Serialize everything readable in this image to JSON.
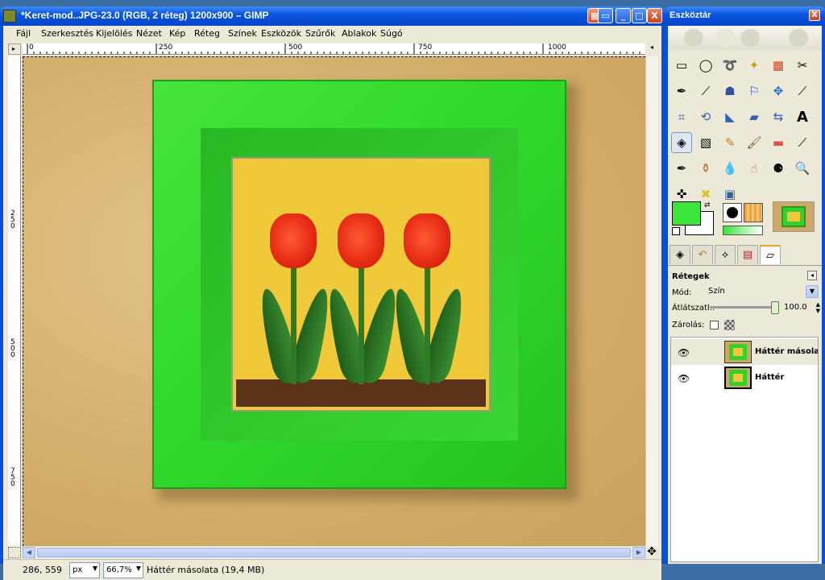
{
  "main_window": {
    "title": "*Keret-mod..JPG-23.0 (RGB, 2 réteg) 1200x900 – GIMP",
    "buttons": {
      "dock": "▦",
      "minimize": "_",
      "maximize": "□",
      "close": "X"
    }
  },
  "menu": [
    {
      "label": "Fájl"
    },
    {
      "label": "Szerkesztés"
    },
    {
      "label": "Kijelölés"
    },
    {
      "label": "Nézet"
    },
    {
      "label": "Kép"
    },
    {
      "label": "Réteg"
    },
    {
      "label": "Színek"
    },
    {
      "label": "Eszközök"
    },
    {
      "label": "Szűrők"
    },
    {
      "label": "Ablakok"
    },
    {
      "label": "Súgó"
    }
  ],
  "ruler_h": {
    "labels": [
      "0",
      "250",
      "500",
      "750",
      "1000"
    ]
  },
  "ruler_v": {
    "labels": [
      "250",
      "500",
      "750"
    ]
  },
  "status": {
    "coords": "286, 559",
    "unit": "px",
    "zoom": "66,7%",
    "info": "Háttér másolata (19,4 MB)"
  },
  "toolbox": {
    "title": "Eszköztár",
    "close": "X",
    "colors": {
      "foreground": "#3ce53a",
      "background": "#ffffff"
    },
    "tools": [
      {
        "name": "rect-select"
      },
      {
        "name": "ellipse-select"
      },
      {
        "name": "free-select"
      },
      {
        "name": "fuzzy-select"
      },
      {
        "name": "select-by-color"
      },
      {
        "name": "scissors"
      },
      {
        "name": "paths"
      },
      {
        "name": "color-picker"
      },
      {
        "name": "zoom-people"
      },
      {
        "name": "measure"
      },
      {
        "name": "move"
      },
      {
        "name": "align"
      },
      {
        "name": "crop"
      },
      {
        "name": "rotate"
      },
      {
        "name": "scale"
      },
      {
        "name": "shear"
      },
      {
        "name": "perspective"
      },
      {
        "name": "text"
      },
      {
        "name": "bucket-fill"
      },
      {
        "name": "blend"
      },
      {
        "name": "pencil"
      },
      {
        "name": "paintbrush"
      },
      {
        "name": "eraser"
      },
      {
        "name": "airbrush"
      },
      {
        "name": "ink"
      },
      {
        "name": "clone"
      },
      {
        "name": "heal"
      },
      {
        "name": "smudge"
      },
      {
        "name": "dodge-burn"
      },
      {
        "name": "magnify"
      },
      {
        "name": "flip"
      },
      {
        "name": "cage"
      },
      {
        "name": "perspective-clone"
      }
    ]
  },
  "layers": {
    "title": "Rétegek",
    "mode_label": "Mód:",
    "mode_value": "Szín",
    "opacity_label": "Átlátszatl.:",
    "opacity_value": "100.0",
    "lock_label": "Zárolás:",
    "items": [
      {
        "name": "Háttér másolata",
        "visible": true,
        "selected": true
      },
      {
        "name": "Háttér",
        "visible": true,
        "selected": false
      }
    ]
  }
}
